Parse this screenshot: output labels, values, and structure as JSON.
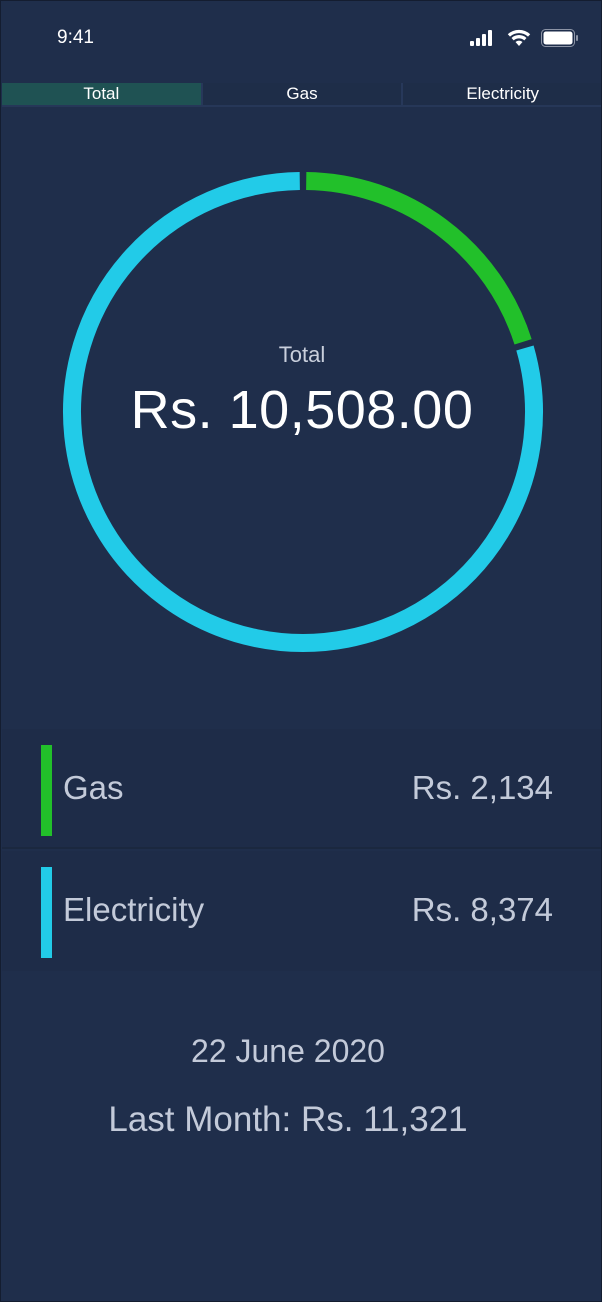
{
  "status_bar": {
    "time": "9:41"
  },
  "tabs": [
    {
      "label": "Total",
      "active": true
    },
    {
      "label": "Gas",
      "active": false
    },
    {
      "label": "Electricity",
      "active": false
    }
  ],
  "summary": {
    "label": "Total",
    "value": "Rs. 10,508.00"
  },
  "chart_data": {
    "type": "pie",
    "categories": [
      "Gas",
      "Electricity"
    ],
    "values": [
      2134,
      8374
    ],
    "colors": [
      "#22c02a",
      "#22cbe8"
    ]
  },
  "breakdown": [
    {
      "label": "Gas",
      "amount": "Rs. 2,134",
      "color": "#22c02a"
    },
    {
      "label": "Electricity",
      "amount": "Rs. 8,374",
      "color": "#22cbe8"
    }
  ],
  "footer": {
    "date": "22 June 2020",
    "last_month": "Last Month: Rs. 11,321"
  },
  "colors": {
    "background": "#1f2e4b",
    "active_tab": "#1f5253",
    "gas": "#22c02a",
    "electricity": "#22cbe8"
  }
}
